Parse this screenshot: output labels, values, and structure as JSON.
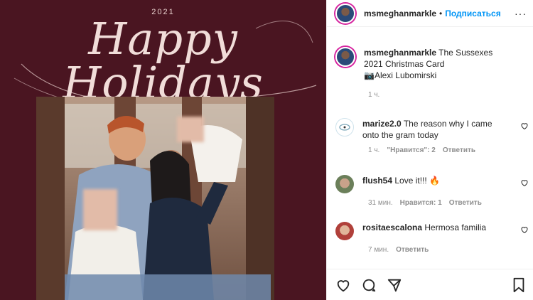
{
  "post": {
    "year": "2021",
    "headline": "Happy Holidays"
  },
  "header": {
    "username": "msmeghanmarkle",
    "dot": "•",
    "follow_label": "Подписаться",
    "more": "···"
  },
  "caption": {
    "username": "msmeghanmarkle",
    "text": "The Sussexes 2021 Christmas Card",
    "credit": "📷Alexi Lubomirski",
    "time": "1 ч."
  },
  "comments": [
    {
      "username": "marize2.0",
      "text": "The reason why I came onto the gram today",
      "time": "1 ч.",
      "likes": "\"Нравится\": 2",
      "reply": "Ответить"
    },
    {
      "username": "flush54",
      "text": "Love it!!! 🔥",
      "time": "31 мин.",
      "likes": "Нравится: 1",
      "reply": "Ответить"
    },
    {
      "username": "rositaescalona",
      "text": "Hermosa familia",
      "time": "7 мин.",
      "reply": "Ответить"
    }
  ],
  "icons": {
    "like": "heart-icon",
    "comment": "comment-icon",
    "share": "share-icon",
    "save": "bookmark-icon",
    "comment_like": "heart-small-icon"
  },
  "colors": {
    "background": "#4a1521",
    "lettering": "#f1ddd9",
    "link": "#0095f6",
    "muted": "#8e8e8e"
  }
}
